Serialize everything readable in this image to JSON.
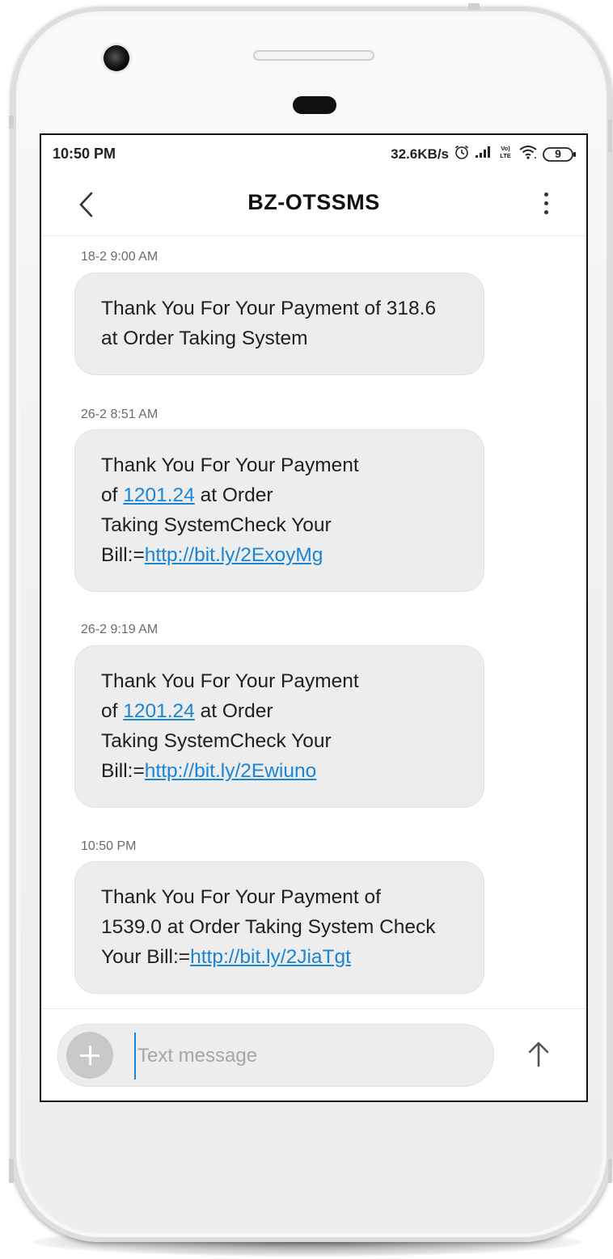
{
  "status_bar": {
    "time": "10:50 PM",
    "net_speed": "32.6KB/s",
    "battery_level": "9"
  },
  "header": {
    "title": "BZ-OTSSMS"
  },
  "messages": [
    {
      "time": "18-2 9:00 AM",
      "lines": [
        [
          {
            "t": "Thank You For Your Payment of 318.6"
          }
        ],
        [
          {
            "t": "at Order Taking System"
          }
        ]
      ]
    },
    {
      "time": "26-2 8:51 AM",
      "lines": [
        [
          {
            "t": "Thank You For Your Payment"
          }
        ],
        [
          {
            "t": "of "
          },
          {
            "t": "1201.24",
            "link": true
          },
          {
            "t": " at Order"
          }
        ],
        [
          {
            "t": "Taking SystemCheck Your"
          }
        ],
        [
          {
            "t": "Bill:="
          },
          {
            "t": "http://bit.ly/2ExoyMg",
            "link": true
          }
        ]
      ]
    },
    {
      "time": "26-2 9:19 AM",
      "lines": [
        [
          {
            "t": "Thank You For Your Payment"
          }
        ],
        [
          {
            "t": "of "
          },
          {
            "t": "1201.24",
            "link": true
          },
          {
            "t": " at Order"
          }
        ],
        [
          {
            "t": "Taking SystemCheck Your"
          }
        ],
        [
          {
            "t": "Bill:="
          },
          {
            "t": "http://bit.ly/2Ewiuno",
            "link": true
          }
        ]
      ]
    },
    {
      "time": "10:50 PM",
      "lines": [
        [
          {
            "t": "Thank You For Your Payment of"
          }
        ],
        [
          {
            "t": "1539.0 at Order Taking System Check"
          }
        ],
        [
          {
            "t": "Your Bill:="
          },
          {
            "t": "http://bit.ly/2JiaTgt",
            "link": true
          }
        ]
      ]
    }
  ],
  "composer": {
    "placeholder": "Text message",
    "value": ""
  },
  "icons": {
    "back": "chevron-left-icon",
    "more": "more-vertical-icon",
    "attach": "plus-icon",
    "send": "arrow-up-icon",
    "alarm": "alarm-icon",
    "signal": "signal-icon",
    "volte": "volte-lte-icon",
    "wifi": "wifi-icon",
    "battery": "battery-icon"
  },
  "colors": {
    "link": "#1a85d6",
    "bubble": "#ededed",
    "cursor": "#1a85d6"
  }
}
